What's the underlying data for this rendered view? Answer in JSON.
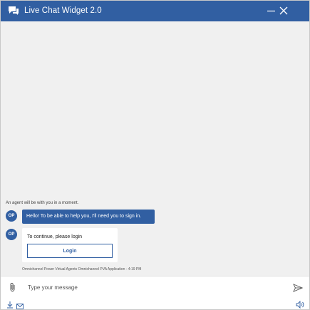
{
  "header": {
    "title": "Live Chat Widget 2.0",
    "icon": "chat-bubbles-icon",
    "minimize_icon": "minimize-icon",
    "close_icon": "close-icon",
    "accent": "#315fa2"
  },
  "transcript": {
    "background": "#f0f0f0",
    "system_message": "An agent will be with you in a moment.",
    "messages": [
      {
        "avatar_initials": "OP",
        "text": "Hello! To be able to help you, I'll need you to sign in."
      },
      {
        "avatar_initials": "OP",
        "card_text": "To continue, please login",
        "button_label": "Login"
      }
    ],
    "meta": "Omnichannel Power Virtual Agents Omnichannel PVA Application - 4:19 PM"
  },
  "composer": {
    "placeholder": "Type your message",
    "attach_icon": "paperclip-icon",
    "send_icon": "send-icon"
  },
  "footer": {
    "download_icon": "download-icon",
    "email_icon": "email-icon",
    "speaker_icon": "speaker-icon"
  }
}
